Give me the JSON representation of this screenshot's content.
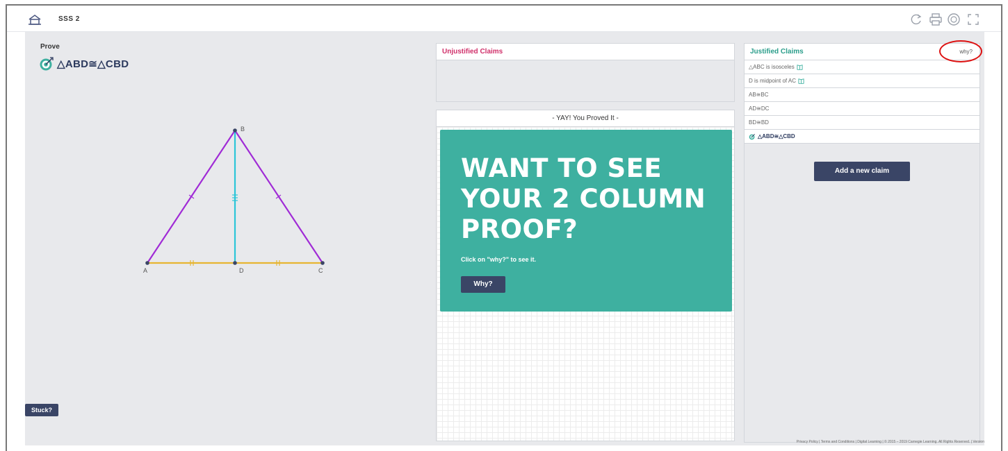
{
  "toolbar": {
    "title": "SSS 2",
    "icons": [
      "home-icon",
      "refresh-icon",
      "print-icon",
      "help-icon",
      "fullscreen-icon"
    ]
  },
  "prove": {
    "label": "Prove",
    "goal": "△ABD≅△CBD",
    "goal_icon": "target-icon"
  },
  "diagram": {
    "points": [
      {
        "label": "B"
      },
      {
        "label": "A"
      },
      {
        "label": "D"
      },
      {
        "label": "C"
      }
    ],
    "colors": {
      "sides": "#a02bd6",
      "median": "#2bc5d8",
      "base": "#e7b531"
    }
  },
  "stuck_label": "Stuck?",
  "unjustified": {
    "title": "Unjustified Claims"
  },
  "yay": {
    "header": "- YAY! You Proved It -",
    "headline": "Want to see your 2 column proof?",
    "subtext": "Click on \"why?\" to see it.",
    "button": "Why?",
    "promo_color": "#3eb0a0"
  },
  "justified": {
    "title": "Justified Claims",
    "why_link": "why?",
    "claims": [
      {
        "text": "△ABC is isosceles",
        "icon": "book-icon"
      },
      {
        "text": "D is midpoint of AC",
        "icon": "book-icon"
      },
      {
        "text": "AB≅BC",
        "icon": ""
      },
      {
        "text": "AD≅DC",
        "icon": ""
      },
      {
        "text": "BD≅BD",
        "icon": ""
      },
      {
        "text": "△ABD≅△CBD",
        "icon": "target-icon"
      }
    ],
    "add_button": "Add a new claim"
  },
  "footer": "Privacy Policy | Terms and Conditions | Digital Learning | © 2015 – 2019 Carnegie Learning. All Rights Reserved. | Version"
}
